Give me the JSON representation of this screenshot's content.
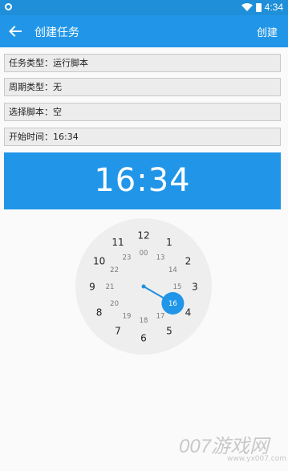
{
  "status_bar": {
    "time": "4:34"
  },
  "app_bar": {
    "title": "创建任务",
    "action_label": "创建"
  },
  "form": {
    "task_type": "任务类型：运行脚本",
    "period_type": "周期类型：无",
    "script": "选择脚本：空",
    "start_time": "开始时间：16:34"
  },
  "time_display": "16:34",
  "clock": {
    "selected_hour": "16",
    "outer_hours": [
      "12",
      "1",
      "2",
      "3",
      "4",
      "5",
      "6",
      "7",
      "8",
      "9",
      "10",
      "11"
    ],
    "inner_hours": [
      "00",
      "13",
      "14",
      "15",
      "16",
      "17",
      "18",
      "19",
      "20",
      "21",
      "22",
      "23"
    ]
  },
  "watermark": {
    "logo": "007游戏网",
    "url": "www.yx007.com"
  },
  "colors": {
    "primary": "#2196e8",
    "status_bar": "#1e8fd8",
    "dial_bg": "#eeeeee"
  }
}
